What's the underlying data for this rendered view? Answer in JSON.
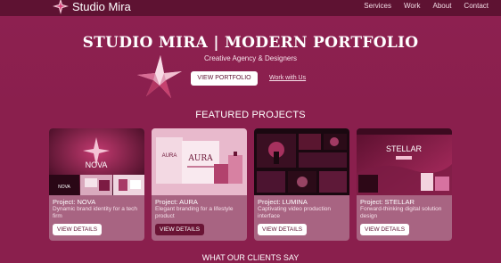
{
  "nav": {
    "brand": "Studio Mira",
    "links": [
      "Services",
      "Work",
      "About",
      "Contact"
    ]
  },
  "hero": {
    "title": "STUDIO MIRA | MODERN PORTFOLIO",
    "subtitle": "Creative Agency & Designers",
    "primary_button": "VIEW PORTFOLIO",
    "secondary_link": "Work with Us"
  },
  "featured": {
    "heading": "FEATURED PROJECTS",
    "cards": [
      {
        "title": "Project: NOVA",
        "description": "Dynamic brand identity for a tech firm",
        "button": "VIEW DETAILS",
        "image_label": "NOVA"
      },
      {
        "title": "Project: AURA",
        "description": "Elegant branding for a lifestyle product",
        "button": "VIEW DETAILS",
        "image_label": "AURA"
      },
      {
        "title": "Project: LUMINA",
        "description": "Captivating video production interface",
        "button": "VIEW DETAILS"
      },
      {
        "title": "Project: STELLAR",
        "description": "Forward-thinking digital solution design",
        "button": "VIEW DETAILS",
        "image_label": "STELLAR"
      }
    ]
  },
  "clients": {
    "heading": "WHAT OUR CLIENTS SAY"
  },
  "colors": {
    "background": "#8a1f4d",
    "nav": "#5e1232",
    "card": "#a86482",
    "accent": "#ffffff"
  }
}
